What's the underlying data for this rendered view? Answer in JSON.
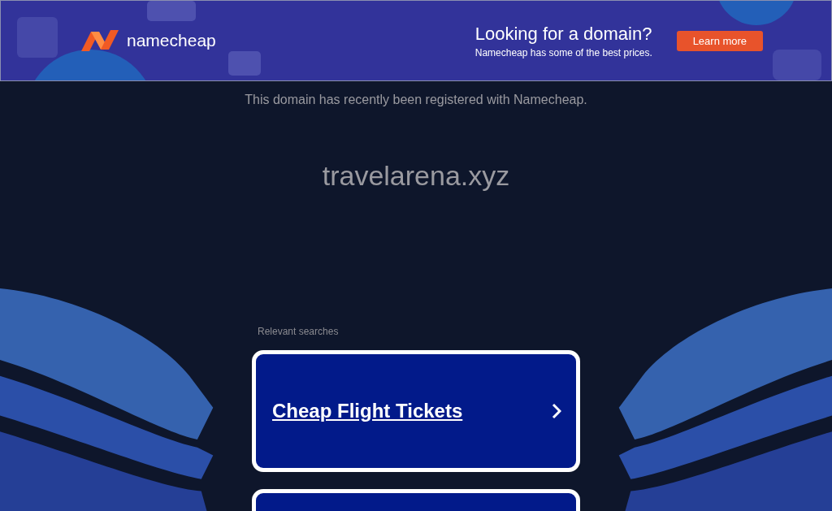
{
  "banner": {
    "logo_text": "namecheap",
    "headline": "Looking for a domain?",
    "subline": "Namecheap has some of the best prices.",
    "button": "Learn more"
  },
  "notice": "This domain has recently been registered with Namecheap.",
  "domain": "travelarena.xyz",
  "searches": {
    "heading": "Relevant searches",
    "items": [
      {
        "label": "Cheap Flight Tickets"
      }
    ]
  }
}
